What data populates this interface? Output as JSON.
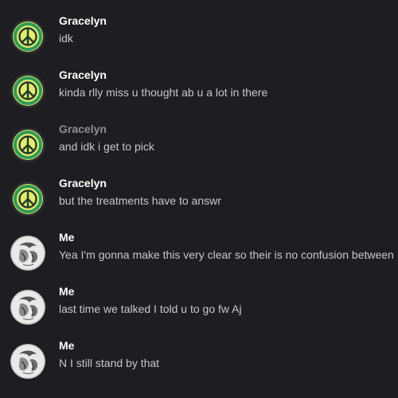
{
  "colors": {
    "background": "#1e1e22",
    "name": "#ffffff",
    "name_dim": "#8e8e96",
    "text": "#c8c8cc",
    "peace_yellow": "#e3ea6e",
    "peace_green": "#2f9a5a"
  },
  "messages": [
    {
      "author": "Gracelyn",
      "text": "idk",
      "avatar": "peace-sign-icon",
      "dim": false
    },
    {
      "author": "Gracelyn",
      "text": "kinda rlly miss u thought ab u a lot in there",
      "avatar": "peace-sign-icon",
      "dim": false
    },
    {
      "author": "Gracelyn",
      "text": "and idk i get to pick",
      "avatar": "peace-sign-icon",
      "dim": true
    },
    {
      "author": "Gracelyn",
      "text": "but the treatments have to answr",
      "avatar": "peace-sign-icon",
      "dim": false
    },
    {
      "author": "Me",
      "text": "Yea I'm gonna make this very clear so their is no confusion between",
      "avatar": "sketch-portrait-icon",
      "dim": false
    },
    {
      "author": "Me",
      "text": "last time we talked I told u to go fw Aj",
      "avatar": "sketch-portrait-icon",
      "dim": false
    },
    {
      "author": "Me",
      "text": "N I still stand by that",
      "avatar": "sketch-portrait-icon",
      "dim": false
    }
  ]
}
